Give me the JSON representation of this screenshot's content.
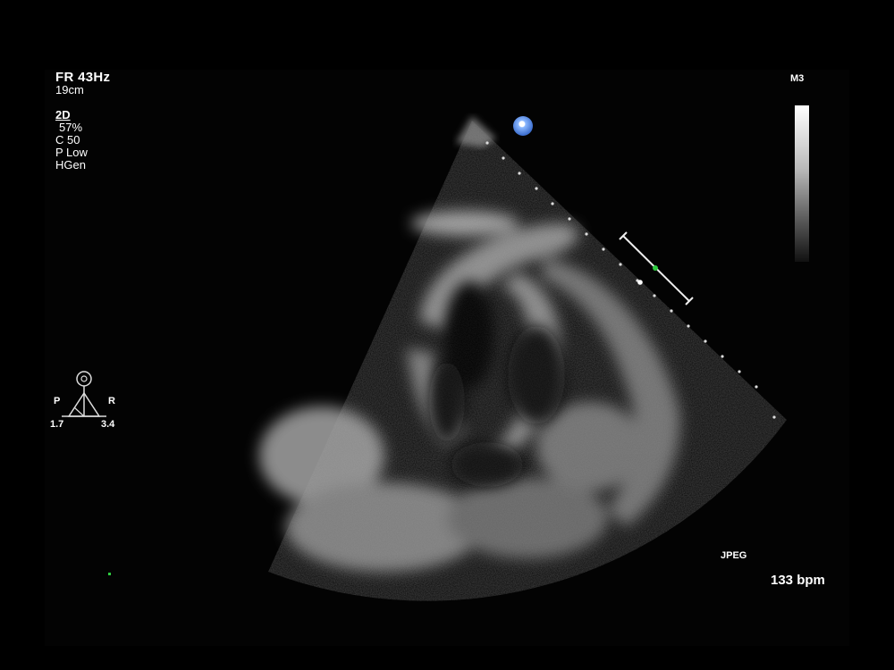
{
  "readout": {
    "frame_rate": "FR 43Hz",
    "depth": "19cm",
    "mode": "2D",
    "gain": "57%",
    "compression": "C 50",
    "power": "P Low",
    "frequency": "HGen"
  },
  "probe": {
    "label": "M3"
  },
  "orientation": {
    "left": "P",
    "right": "R",
    "left_value": "1.7",
    "right_value": "3.4"
  },
  "footer": {
    "format": "JPEG",
    "heart_rate": "133 bpm"
  },
  "colors": {
    "background": "#000000",
    "marker": "#3d6fcf",
    "caliper_dot": "#2ecc40"
  },
  "icons": {
    "orientation": "probe-orientation-icon",
    "marker": "orientation-marker-icon"
  }
}
